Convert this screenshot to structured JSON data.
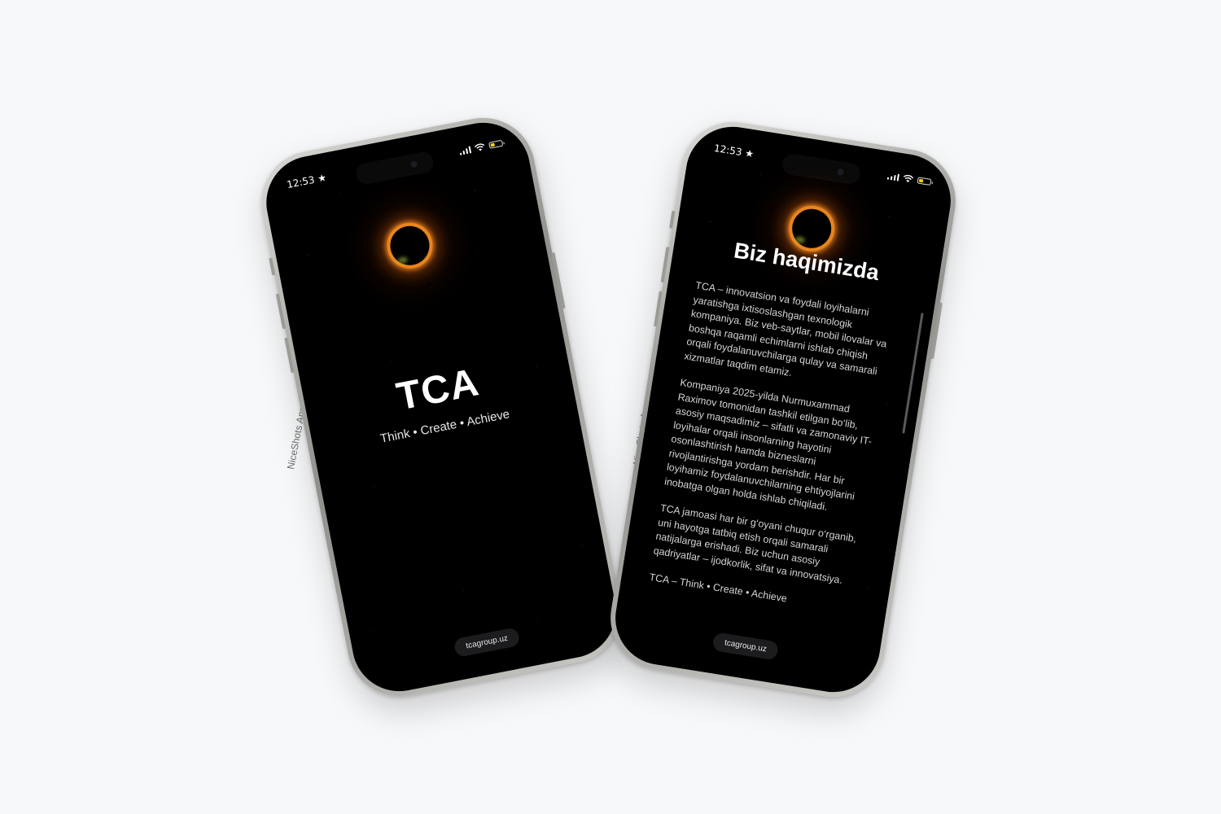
{
  "watermark": "NiceShots App",
  "left_phone": {
    "status": {
      "time": "12:53"
    },
    "brand": "TCA",
    "tagline": "Think • Create • Achieve",
    "url": "tcagroup.uz"
  },
  "right_phone": {
    "status": {
      "time": "12:53"
    },
    "title": "Biz haqimizda",
    "paragraphs": [
      "TCA – innovatsion va foydali loyihalarni yaratishga ixtisoslashgan texnologik kompaniya. Biz veb-saytlar, mobil ilovalar va boshqa raqamli echimlarni ishlab chiqish orqali foydalanuvchilarga qulay va samarali xizmatlar taqdim etamiz.",
      "Kompaniya 2025-yilda Nurmuxammad Raximov tomonidan tashkil etilgan bo‘lib, asosiy maqsadimiz – sifatli va zamonaviy IT-loyihalar orqali insonlarning hayotini osonlashtirish hamda bizneslarni rivojlantirishga yordam berishdir. Har bir loyihamiz foydalanuvchilarning ehtiyojlarini inobatga olgan holda ishlab chiqiladi.",
      "TCA jamoasi har bir g‘oyani chuqur o‘rganib, uni hayotga tatbiq etish orqali samarali natijalarga erishadi. Biz uchun asosiy qadriyatlar – ijodkorlik, sifat va innovatsiya.",
      "TCA – Think • Create • Achieve"
    ],
    "url": "tcagroup.uz"
  },
  "colors": {
    "background": "#f7f8f9",
    "screen": "#000000",
    "accent_orange": "#e9851f",
    "battery_yellow": "#f2d21b"
  }
}
